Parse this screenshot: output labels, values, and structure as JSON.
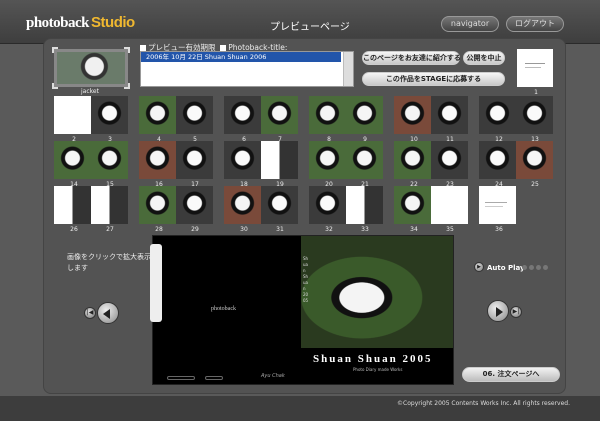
{
  "header": {
    "logo_photoback": "photoback",
    "logo_studio": "Studio",
    "title": "プレビューページ",
    "navigator_label": "navigator",
    "logout_label": "ログアウト"
  },
  "jacket": {
    "label": "jacket"
  },
  "checks": {
    "preview_valid": "プレビュー有効期限",
    "photoback_title": "Photoback-title:"
  },
  "title_box": {
    "value": "2006年 10月 22日  Shuan Shuan 2006"
  },
  "actions": {
    "introduce": "このページをお友達に紹介する",
    "stop_public": "公開を中止",
    "stage": "この作品をSTAGEに応募する"
  },
  "pages": [
    "1",
    "2",
    "3",
    "4",
    "5",
    "6",
    "7",
    "8",
    "9",
    "10",
    "11",
    "12",
    "13",
    "14",
    "15",
    "16",
    "17",
    "18",
    "19",
    "20",
    "21",
    "22",
    "23",
    "24",
    "25",
    "26",
    "27",
    "28",
    "29",
    "30",
    "31",
    "32",
    "33",
    "34",
    "35",
    "36"
  ],
  "hint": "画像をクリックで拡大表示します",
  "spread": {
    "mini_logo": "photoback",
    "title": "Shuan Shuan 2005",
    "subtitle": "Photo Diary made Works",
    "vertical": "Shuan Shuan 2005",
    "sig": "Ayu Chak"
  },
  "autoplay": {
    "label": "Auto Play"
  },
  "order": {
    "label": "06. 注文ページへ"
  },
  "footer": {
    "copyright": "©Copyright 2005 Contents Works Inc.  All rights reserved."
  }
}
